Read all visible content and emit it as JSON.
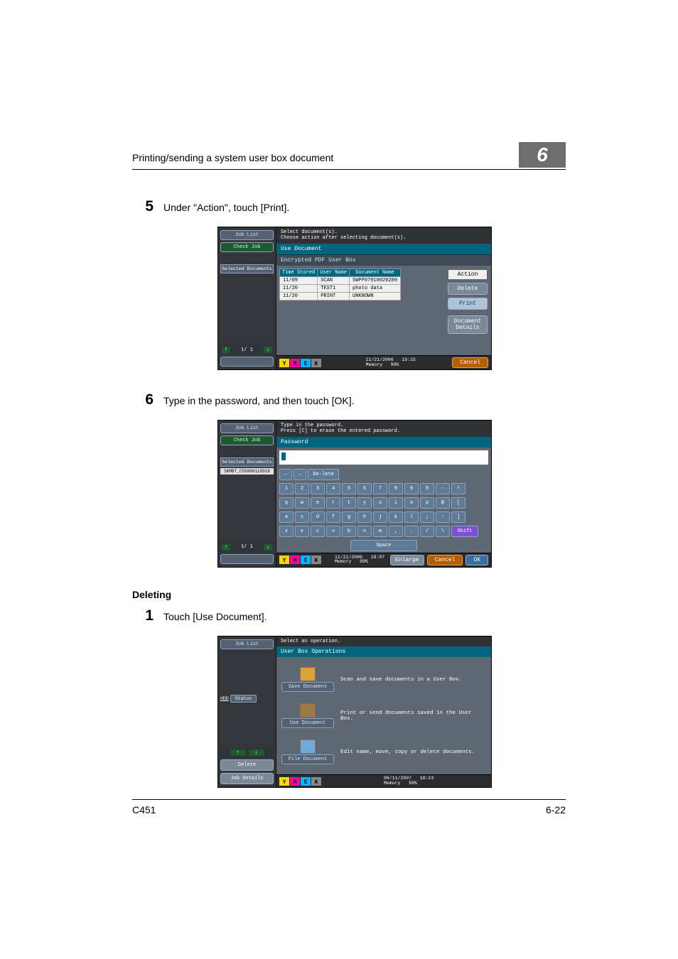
{
  "header": {
    "title": "Printing/sending a system user box document",
    "chapter": "6"
  },
  "steps": {
    "s5": {
      "num": "5",
      "text": "Under \"Action\", touch [Print]."
    },
    "s6": {
      "num": "6",
      "text": "Type in the password, and then touch [OK]."
    },
    "s1": {
      "num": "1",
      "text": "Touch [Use Document]."
    }
  },
  "section": {
    "deleting": "Deleting"
  },
  "ss1": {
    "top1": "Select document(s).",
    "top2": "Choose action after selecting document(s).",
    "joblist": "Job List",
    "checkjob": "Check Job",
    "selectedDocs": "Selected Documents",
    "useDoc": "Use Document",
    "boxTitle": "Encrypted PDF User Box",
    "cols": {
      "time": "Time Stored",
      "user": "User Name",
      "doc": "Document Name"
    },
    "rows": [
      {
        "t": "11/09",
        "u": "SCAN",
        "d": "SWPP07010020200"
      },
      {
        "t": "11/20",
        "u": "TEST1",
        "d": "photo data"
      },
      {
        "t": "11/20",
        "u": "PRINT",
        "d": "UNKNOWN"
      }
    ],
    "pageBadge": "1/ 1",
    "action": "Action",
    "delete": "Delete",
    "print": "Print",
    "docDetails": "Document Details",
    "cancel": "Cancel",
    "date": "11/21/2006",
    "time": "19:15",
    "memLabel": "Memory",
    "memPct": "99%",
    "pager": "1/  1"
  },
  "ss2": {
    "top1": "Type in the password.",
    "top2": "Press [C] to erase the entered password.",
    "joblist": "Job List",
    "checkjob": "Check Job",
    "selectedDocs": "Selected Documents",
    "selItem": "SKMBT_C55006110918",
    "password": "Password",
    "delete": "De-lete",
    "kb_row1": [
      "1",
      "2",
      "3",
      "4",
      "5",
      "6",
      "7",
      "8",
      "9",
      "0",
      "-",
      "^"
    ],
    "kb_row2": [
      "q",
      "w",
      "e",
      "r",
      "t",
      "y",
      "u",
      "i",
      "o",
      "p",
      "@",
      "["
    ],
    "kb_row3": [
      "a",
      "s",
      "d",
      "f",
      "g",
      "h",
      "j",
      "k",
      "l",
      ";",
      ":",
      "]"
    ],
    "kb_row4": [
      "z",
      "x",
      "c",
      "v",
      "b",
      "n",
      "m",
      ",",
      ".",
      "/",
      "\\"
    ],
    "shift": "Shift",
    "space": "Space",
    "enlarge": "Enlarge",
    "cancel": "Cancel",
    "ok": "OK",
    "date": "11/21/2006",
    "time": "19:07",
    "memLabel": "Memory",
    "memPct": "99%",
    "pager": "1/  1"
  },
  "ss3": {
    "top": "Select an operation.",
    "joblist": "Job List",
    "userBoxOps": "User Box Operations",
    "ops": [
      {
        "label": "Save Document",
        "desc": "Scan and save documents in a User Box."
      },
      {
        "label": "Use Document",
        "desc": "Print or send documents saved in the User Box."
      },
      {
        "label": "File Document",
        "desc": "Edit name, move, copy or delete documents."
      }
    ],
    "status": "Status",
    "hdd": "HDD",
    "delete": "Delete",
    "jobDetails": "Job Details",
    "date": "06/11/2007",
    "time": "18:23",
    "memLabel": "Memory",
    "memPct": "99%"
  },
  "footer": {
    "left": "C451",
    "right": "6-22"
  },
  "ymck": {
    "y": "Y",
    "m": "M",
    "c": "C",
    "k": "K"
  }
}
